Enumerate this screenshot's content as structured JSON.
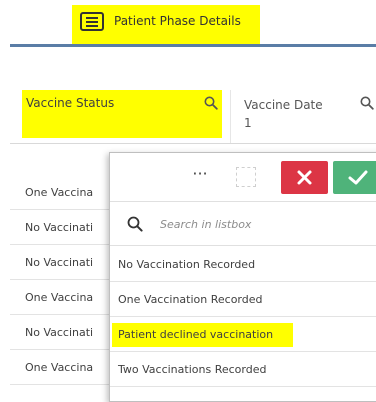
{
  "tab": {
    "label": "Patient Phase Details",
    "icon": "list-icon"
  },
  "table": {
    "columns": [
      {
        "label": "Vaccine Status",
        "icon": "search-icon"
      },
      {
        "label": "Vaccine Date",
        "sub": "1",
        "icon": "search-icon"
      }
    ],
    "rows": [
      "One Vaccina",
      "No Vaccinati",
      "No Vaccinati",
      "One Vaccina",
      "No Vaccinati",
      "One Vaccina"
    ]
  },
  "listbox": {
    "more_label": "···",
    "search_placeholder": "Search in listbox",
    "items": [
      "No Vaccination Recorded",
      "One Vaccination Recorded",
      "Patient declined vaccination",
      "Two Vaccinations Recorded"
    ],
    "highlighted_index": 2
  },
  "colors": {
    "highlight": "#ffff00",
    "cancel": "#dc3545",
    "confirm": "#4fb37a",
    "tab_underline": "#5a7da6"
  }
}
